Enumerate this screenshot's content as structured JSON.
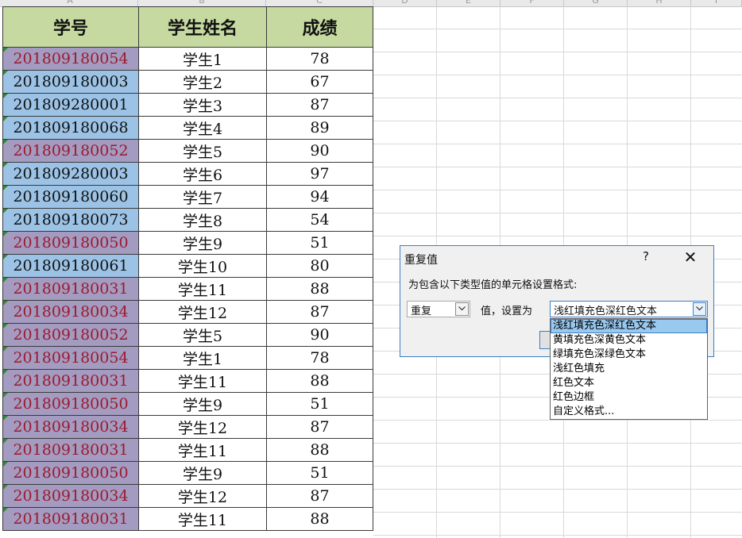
{
  "column_letters": [
    "A",
    "B",
    "C",
    "D",
    "E",
    "F",
    "G",
    "H",
    "I"
  ],
  "sheet": {
    "headers": [
      "学号",
      "学生姓名",
      "成绩"
    ],
    "rows": [
      {
        "id": "201809180054",
        "name": "学生1",
        "score": "78",
        "dup": true
      },
      {
        "id": "201809180003",
        "name": "学生2",
        "score": "67",
        "dup": false
      },
      {
        "id": "201809280001",
        "name": "学生3",
        "score": "87",
        "dup": false
      },
      {
        "id": "201809180068",
        "name": "学生4",
        "score": "89",
        "dup": false
      },
      {
        "id": "201809180052",
        "name": "学生5",
        "score": "90",
        "dup": true
      },
      {
        "id": "201809280003",
        "name": "学生6",
        "score": "97",
        "dup": false
      },
      {
        "id": "201809180060",
        "name": "学生7",
        "score": "94",
        "dup": false
      },
      {
        "id": "201809180073",
        "name": "学生8",
        "score": "54",
        "dup": false
      },
      {
        "id": "201809180050",
        "name": "学生9",
        "score": "51",
        "dup": true
      },
      {
        "id": "201809180061",
        "name": "学生10",
        "score": "80",
        "dup": false
      },
      {
        "id": "201809180031",
        "name": "学生11",
        "score": "88",
        "dup": true
      },
      {
        "id": "201809180034",
        "name": "学生12",
        "score": "87",
        "dup": true
      },
      {
        "id": "201809180052",
        "name": "学生5",
        "score": "90",
        "dup": true
      },
      {
        "id": "201809180054",
        "name": "学生1",
        "score": "78",
        "dup": true
      },
      {
        "id": "201809180031",
        "name": "学生11",
        "score": "88",
        "dup": true
      },
      {
        "id": "201809180050",
        "name": "学生9",
        "score": "51",
        "dup": true
      },
      {
        "id": "201809180034",
        "name": "学生12",
        "score": "87",
        "dup": true
      },
      {
        "id": "201809180031",
        "name": "学生11",
        "score": "88",
        "dup": true
      },
      {
        "id": "201809180050",
        "name": "学生9",
        "score": "51",
        "dup": true
      },
      {
        "id": "201809180034",
        "name": "学生12",
        "score": "87",
        "dup": true
      },
      {
        "id": "201809180031",
        "name": "学生11",
        "score": "88",
        "dup": true
      }
    ]
  },
  "dialog": {
    "title": "重复值",
    "help": "?",
    "close": "✕",
    "prompt": "为包含以下类型值的单元格设置格式:",
    "type_value": "重复",
    "mid_label": "值，设置为",
    "format_value": "浅红填充色深红色文本",
    "options": [
      "浅红填充色深红色文本",
      "黄填充色深黄色文本",
      "绿填充色深绿色文本",
      "浅红色填充",
      "红色文本",
      "红色边框",
      "自定义格式..."
    ],
    "highlighted_option": 0
  },
  "colors": {
    "header_bg": "#c5d9a0",
    "id_bg": "#9cc3e6",
    "dup_bg": "#a39bc0",
    "dup_text": "#9c1a2e",
    "accent": "#3c7fc9"
  },
  "icons": {
    "dropdown": "chevron-down-icon",
    "close": "close-icon",
    "help": "help-icon"
  }
}
